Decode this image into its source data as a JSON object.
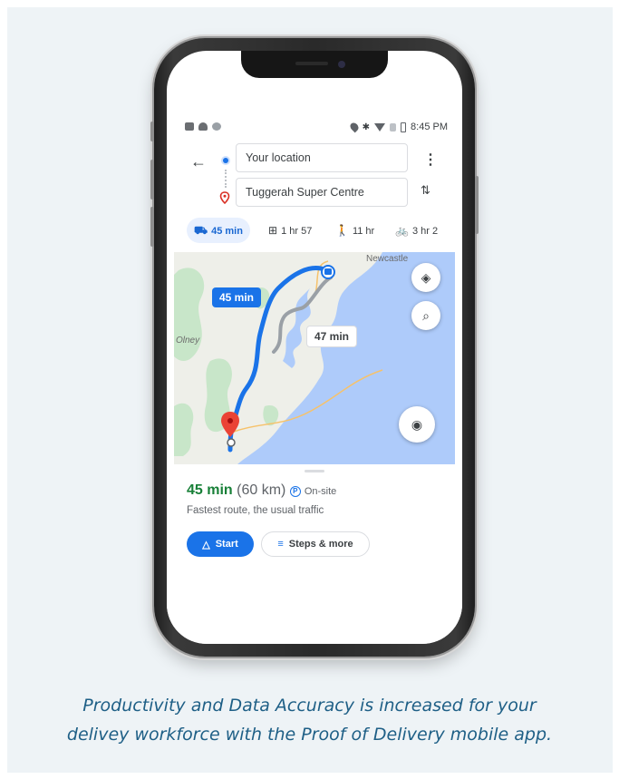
{
  "status_bar": {
    "time": "8:45 PM"
  },
  "directions": {
    "origin": "Your location",
    "destination": "Tuggerah Super Centre"
  },
  "modes": [
    {
      "icon": "car-icon",
      "label": "45 min",
      "active": true
    },
    {
      "icon": "transit-icon",
      "label": "1 hr 57"
    },
    {
      "icon": "walk-icon",
      "label": "11 hr"
    },
    {
      "icon": "bike-icon",
      "label": "3 hr 2"
    }
  ],
  "map": {
    "labels": {
      "town_newcastle": "Newcastle",
      "town_olney": "Olney"
    },
    "route_primary": "45 min",
    "route_alt": "47 min",
    "colors": {
      "water": "#aecbfa",
      "land": "#f1f3f4",
      "park": "#c8e6c9",
      "route": "#1a73e8",
      "alt_route": "#9aa0a6"
    }
  },
  "summary": {
    "time": "45 min",
    "distance": "(60 km)",
    "parking": "On-site",
    "description": "Fastest route, the usual traffic",
    "start_label": "Start",
    "steps_label": "Steps & more"
  },
  "caption": {
    "line1": "Productivity and Data Accuracy is increased for your",
    "line2": "delivey workforce with the Proof of Delivery mobile app."
  }
}
